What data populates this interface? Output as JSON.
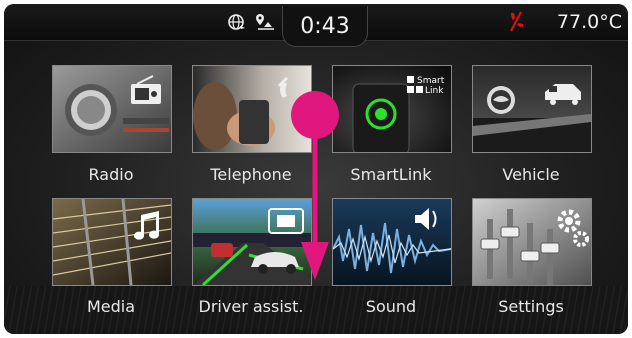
{
  "status_bar": {
    "time": "0:43",
    "temperature": "77.0°C",
    "icons": [
      "globe-icon",
      "navigation-icon",
      "phone-alert-icon"
    ],
    "alert_color": "#e01010"
  },
  "menu": {
    "items": [
      {
        "label": "Radio",
        "icon": "radio-icon"
      },
      {
        "label": "Telephone",
        "icon": "telephone-icon"
      },
      {
        "label": "SmartLink",
        "icon": "smartlink-icon",
        "tile_text": [
          "Smart",
          "Link"
        ]
      },
      {
        "label": "Vehicle",
        "icon": "vehicle-icon"
      },
      {
        "label": "Media",
        "icon": "media-icon"
      },
      {
        "label": "Driver assist.",
        "icon": "driver-assist-icon"
      },
      {
        "label": "Sound",
        "icon": "sound-icon"
      },
      {
        "label": "Settings",
        "icon": "settings-icon"
      }
    ]
  },
  "gesture": {
    "type": "swipe-down",
    "color": "#e0187d"
  }
}
